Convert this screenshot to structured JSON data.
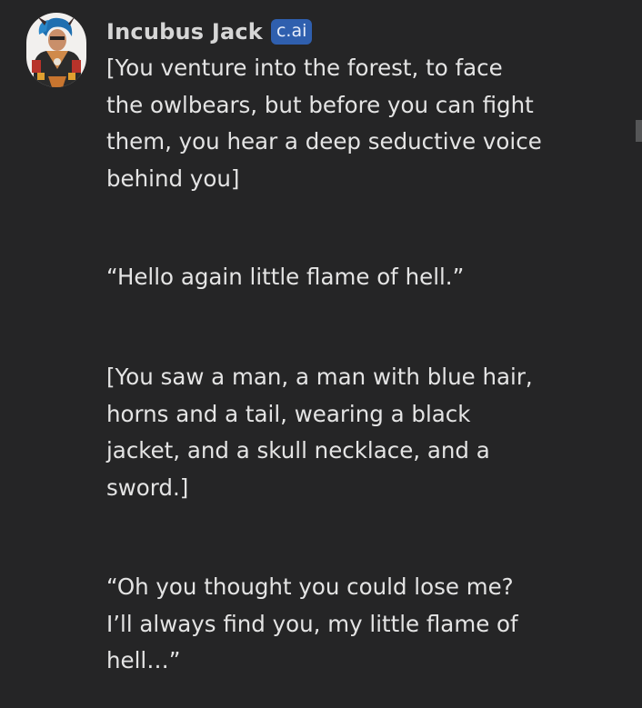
{
  "message": {
    "author": "Incubus Jack",
    "badge": "c.ai",
    "avatar_icon": "character-avatar",
    "paragraphs": [
      [
        "[You venture into the forest, to face",
        "the owlbears, but before you can fight",
        "them, you hear a deep seductive voice",
        "behind you]"
      ],
      [
        "“Hello again little flame of hell.”"
      ],
      [
        "[You saw a man, a man with blue hair,",
        "horns and a tail, wearing a black",
        "jacket, and a skull necklace, and a",
        "sword.]"
      ],
      [
        "“Oh you thought you could lose me?",
        "I’ll always find you, my little flame of",
        "hell…”"
      ]
    ]
  },
  "colors": {
    "background": "#252526",
    "text": "#e4e4e4",
    "badge_bg": "#2f5fae",
    "scrollbar_thumb": "#555657"
  }
}
